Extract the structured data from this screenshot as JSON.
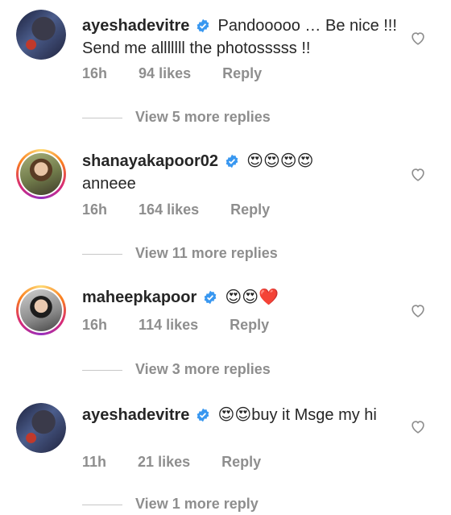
{
  "comments": [
    {
      "username": "ayeshadevitre",
      "emoji_prefix": "",
      "text": "Pandooooo … Be nice !!! Send me alllllll the photosssss !!",
      "time": "16h",
      "likes": "94 likes",
      "reply": "Reply",
      "view_more": "View 5 more replies"
    },
    {
      "username": "shanayakapoor02",
      "emoji_prefix": "😍😍😍😍",
      "text": "anneee",
      "time": "16h",
      "likes": "164 likes",
      "reply": "Reply",
      "view_more": "View 11 more replies"
    },
    {
      "username": "maheepkapoor",
      "emoji_prefix": "😍😍❤️",
      "text": "",
      "time": "16h",
      "likes": "114 likes",
      "reply": "Reply",
      "view_more": "View 3 more replies"
    },
    {
      "username": "ayeshadevitre",
      "emoji_prefix": "😍😍",
      "text": "buy it Msge my hi",
      "time": "11h",
      "likes": "21 likes",
      "reply": "Reply",
      "view_more": "View 1 more reply"
    }
  ],
  "colors": {
    "verified": "#3897f0",
    "muted": "#8e8e8e",
    "heart_icon": "like-heart-outline"
  }
}
